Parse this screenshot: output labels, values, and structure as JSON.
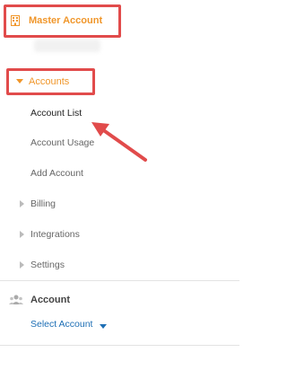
{
  "sidebar": {
    "master_account_label": "Master Account",
    "accounts_label": "Accounts",
    "sub_items": [
      {
        "label": "Account List"
      },
      {
        "label": "Account Usage"
      },
      {
        "label": "Add Account"
      }
    ],
    "groups": [
      {
        "label": "Billing"
      },
      {
        "label": "Integrations"
      },
      {
        "label": "Settings"
      }
    ],
    "account_section": {
      "title": "Account",
      "select_label": "Select Account"
    }
  },
  "colors": {
    "accent_orange": "#f0962a",
    "annotation_red": "#e14b4b",
    "link_blue": "#1e6fb5"
  }
}
